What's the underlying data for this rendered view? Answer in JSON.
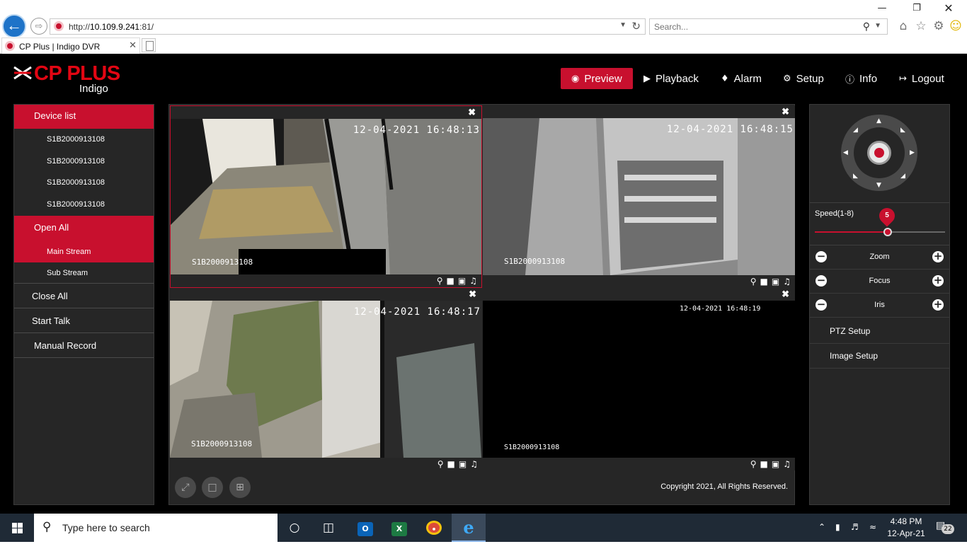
{
  "browser": {
    "url_prefix": "http://",
    "url_host": "10.109.9.241",
    "url_suffix": ":81/",
    "search_placeholder": "Search...",
    "tab_title": "CP Plus | Indigo DVR"
  },
  "app": {
    "brand": "CP PLUS",
    "product": "Indigo",
    "nav": {
      "preview": "Preview",
      "playback": "Playback",
      "alarm": "Alarm",
      "setup": "Setup",
      "info": "Info",
      "logout": "Logout"
    },
    "left_panel": {
      "device_list": "Device list",
      "devices": [
        "S1B2000913108",
        "S1B2000913108",
        "S1B2000913108",
        "S1B2000913108"
      ],
      "open_all": "Open All",
      "main_stream": "Main Stream",
      "sub_stream": "Sub Stream",
      "close_all": "Close All",
      "start_talk": "Start Talk",
      "manual_record": "Manual Record"
    },
    "cameras": [
      {
        "timestamp": "12-04-2021 16:48:13",
        "id": "S1B2000913108"
      },
      {
        "timestamp": "12-04-2021 16:48:15",
        "id": "S1B2000913108"
      },
      {
        "timestamp": "12-04-2021 16:48:17",
        "id": "S1B2000913108"
      },
      {
        "timestamp": "12-04-2021 16:48:19",
        "id": "S1B2000913108"
      }
    ],
    "copyright": "Copyright 2021, All Rights Reserved.",
    "ptz": {
      "speed_label": "Speed(1-8)",
      "speed_value": "5",
      "speed_fraction": 0.56,
      "zoom": "Zoom",
      "focus": "Focus",
      "iris": "Iris",
      "ptz_setup": "PTZ Setup",
      "image_setup": "Image Setup"
    },
    "colors": {
      "accent": "#c8102e",
      "panel": "#262626"
    }
  },
  "taskbar": {
    "search_placeholder": "Type here to search",
    "time": "4:48 PM",
    "date": "12-Apr-21",
    "notification_count": "22"
  }
}
